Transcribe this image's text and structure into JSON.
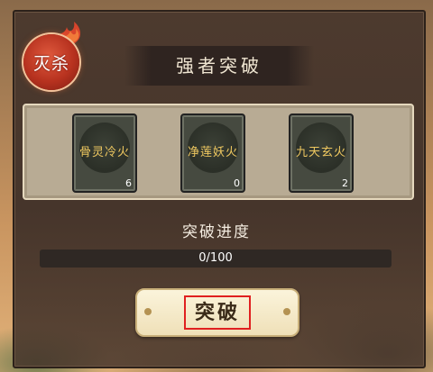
{
  "emblem": {
    "label": "灭杀",
    "icon": "fire-emblem-icon"
  },
  "title": "强者突破",
  "slots": [
    {
      "name": "骨灵冷火",
      "count": "6"
    },
    {
      "name": "净莲妖火",
      "count": "0"
    },
    {
      "name": "九天玄火",
      "count": "2"
    }
  ],
  "progress": {
    "label": "突破进度",
    "text": "0/100",
    "value": 0,
    "max": 100
  },
  "break_button": {
    "label": "突破"
  },
  "colors": {
    "panel": "#46352b",
    "slot_text": "#efc860",
    "progress_fill": "#e7a94a",
    "highlight_box": "#e02020"
  }
}
